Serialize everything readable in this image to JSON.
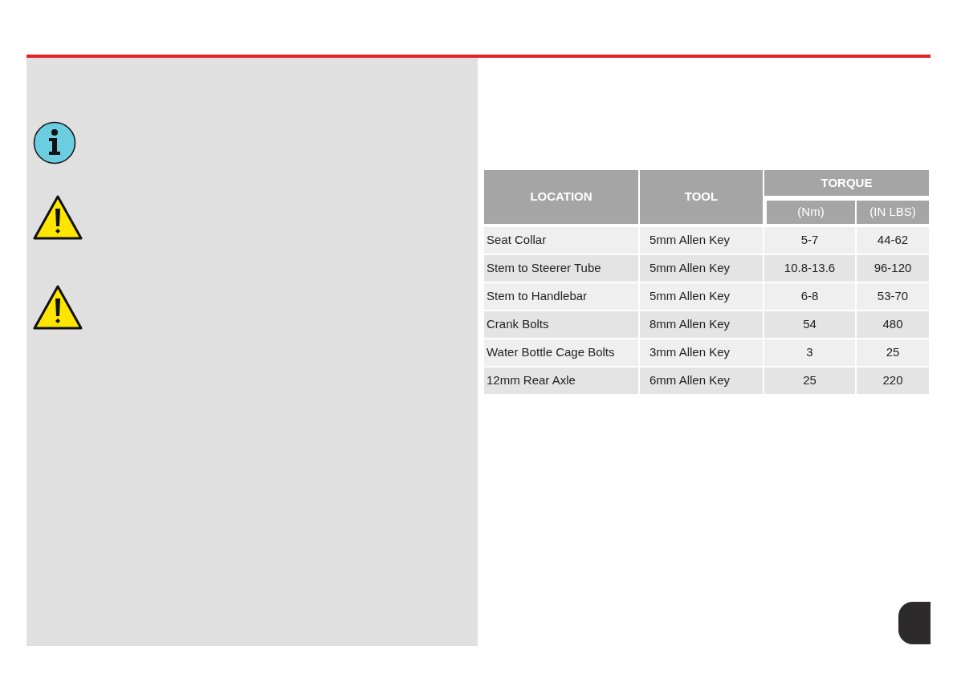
{
  "torque_table": {
    "columns": {
      "location": "LOCATION",
      "tool": "TOOL",
      "torque": "TORQUE",
      "nm": "(Nm)",
      "in_lbs": "(IN LBS)"
    },
    "rows": [
      {
        "location": "Seat Collar",
        "tool": "5mm Allen Key",
        "nm": "5-7",
        "in_lbs": "44-62"
      },
      {
        "location": "Stem to Steerer Tube",
        "tool": "5mm Allen Key",
        "nm": "10.8-13.6",
        "in_lbs": "96-120"
      },
      {
        "location": "Stem to Handlebar",
        "tool": "5mm Allen Key",
        "nm": "6-8",
        "in_lbs": "53-70"
      },
      {
        "location": "Crank Bolts",
        "tool": "8mm Allen Key",
        "nm": "54",
        "in_lbs": "480"
      },
      {
        "location": "Water Bottle Cage Bolts",
        "tool": "3mm Allen Key",
        "nm": "3",
        "in_lbs": "25"
      },
      {
        "location": "12mm Rear Axle",
        "tool": "6mm Allen Key",
        "nm": "25",
        "in_lbs": "220"
      }
    ]
  }
}
